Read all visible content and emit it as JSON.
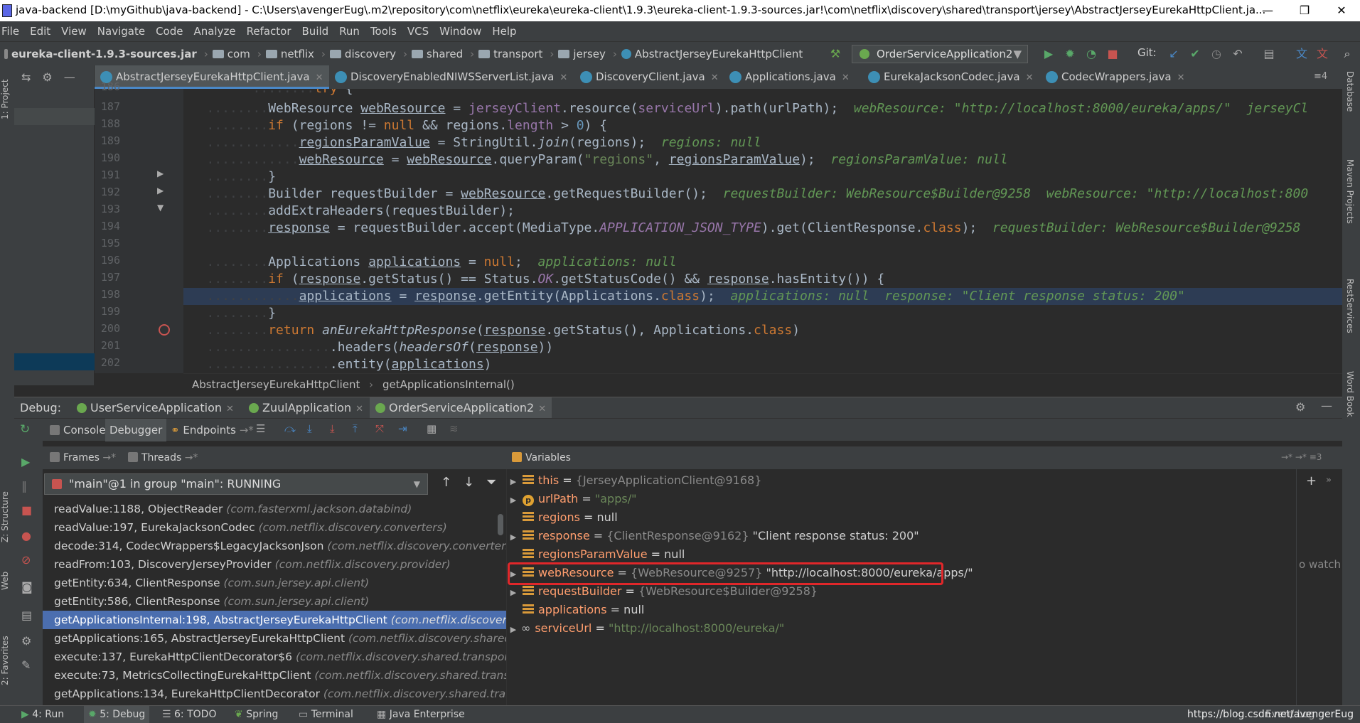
{
  "window": {
    "title": "java-backend [D:\\myGithub\\java-backend] - C:\\Users\\avengerEug\\.m2\\repository\\com\\netflix\\eureka\\eureka-client\\1.9.3\\eureka-client-1.9.3-sources.jar!\\com\\netflix\\discovery\\shared\\transport\\jersey\\AbstractJerseyEurekaHttpClient.ja...",
    "minimize": "—",
    "restore": "❐",
    "close": "✕"
  },
  "menu": [
    "File",
    "Edit",
    "View",
    "Navigate",
    "Code",
    "Analyze",
    "Refactor",
    "Build",
    "Run",
    "Tools",
    "VCS",
    "Window",
    "Help"
  ],
  "nav": {
    "jar": "eureka-client-1.9.3-sources.jar",
    "crumbs": [
      "com",
      "netflix",
      "discovery",
      "shared",
      "transport",
      "jersey"
    ],
    "cls": "AbstractJerseyEurekaHttpClient",
    "run_config": "OrderServiceApplication2",
    "git_label": "Git:"
  },
  "side": {
    "project": "1: Project",
    "structure": "Z: Structure",
    "web": "Web",
    "favorites": "2: Favorites",
    "database": "Database",
    "maven": "Maven Projects",
    "rest": "RestServices",
    "wordbook": "Word Book"
  },
  "tabs": [
    {
      "label": "AbstractJerseyEurekaHttpClient.java",
      "active": true
    },
    {
      "label": "DiscoveryEnabledNIWSServerList.java",
      "active": false
    },
    {
      "label": "DiscoveryClient.java",
      "active": false
    },
    {
      "label": "Applications.java",
      "active": false
    },
    {
      "label": "EurekaJacksonCodec.java",
      "active": false
    },
    {
      "label": "CodecWrappers.java",
      "active": false
    }
  ],
  "tabs_more": "≡4",
  "line_numbers": [
    "186",
    "187",
    "188",
    "189",
    "190",
    "191",
    "192",
    "193",
    "194",
    "195",
    "196",
    "197",
    "198",
    "199",
    "200",
    "201",
    "202"
  ],
  "editor_breadcrumb": {
    "cls": "AbstractJerseyEurekaHttpClient",
    "method": "getApplicationsInternal()"
  },
  "debug": {
    "label": "Debug:",
    "sessions": [
      "UserServiceApplication",
      "ZuulApplication",
      "OrderServiceApplication2"
    ],
    "toolbar": {
      "console": "Console",
      "debugger": "Debugger",
      "endpoints": "Endpoints"
    },
    "frames_label": "Frames",
    "threads_label": "Threads",
    "thread_selected": "\"main\"@1 in group \"main\": RUNNING",
    "frames": [
      {
        "m": "readValue:1188, ObjectReader",
        "p": "(com.fasterxml.jackson.databind)",
        "sel": false
      },
      {
        "m": "readValue:197, EurekaJacksonCodec",
        "p": "(com.netflix.discovery.converters)",
        "sel": false
      },
      {
        "m": "decode:314, CodecWrappers$LegacyJacksonJson",
        "p": "(com.netflix.discovery.converters.wra",
        "sel": false
      },
      {
        "m": "readFrom:103, DiscoveryJerseyProvider",
        "p": "(com.netflix.discovery.provider)",
        "sel": false
      },
      {
        "m": "getEntity:634, ClientResponse",
        "p": "(com.sun.jersey.api.client)",
        "sel": false
      },
      {
        "m": "getEntity:586, ClientResponse",
        "p": "(com.sun.jersey.api.client)",
        "sel": false
      },
      {
        "m": "getApplicationsInternal:198, AbstractJerseyEurekaHttpClient",
        "p": "(com.netflix.discovery.sha",
        "sel": true
      },
      {
        "m": "getApplications:165, AbstractJerseyEurekaHttpClient",
        "p": "(com.netflix.discovery.shared.tran",
        "sel": false
      },
      {
        "m": "execute:137, EurekaHttpClientDecorator$6",
        "p": "(com.netflix.discovery.shared.transport.dec",
        "sel": false
      },
      {
        "m": "execute:73, MetricsCollectingEurekaHttpClient",
        "p": "(com.netflix.discovery.shared.transport.",
        "sel": false
      },
      {
        "m": "getApplications:134, EurekaHttpClientDecorator",
        "p": "(com.netflix.discovery.shared.transpo",
        "sel": false
      }
    ],
    "variables_label": "Variables",
    "watches_hint": "o watch",
    "variables": [
      {
        "name": "this",
        "eq": " = ",
        "ref": "{JerseyApplicationClient@9168}",
        "val": "",
        "str": "",
        "exp": true,
        "icon": "field"
      },
      {
        "name": "urlPath",
        "eq": " = ",
        "ref": "",
        "val": "",
        "str": "\"apps/\"",
        "exp": true,
        "icon": "p"
      },
      {
        "name": "regions",
        "eq": " = ",
        "ref": "",
        "val": "null",
        "str": "",
        "exp": false,
        "icon": "field"
      },
      {
        "name": "response",
        "eq": " = ",
        "ref": "{ClientResponse@9162}",
        "val": " \"Client response status: 200\"",
        "str": "",
        "exp": true,
        "icon": "field"
      },
      {
        "name": "regionsParamValue",
        "eq": " = ",
        "ref": "",
        "val": "null",
        "str": "",
        "exp": false,
        "icon": "field"
      },
      {
        "name": "webResource",
        "eq": " = ",
        "ref": "{WebResource@9257}",
        "val": " \"http://localhost:8000/eureka/apps/\"",
        "str": "",
        "exp": true,
        "icon": "field"
      },
      {
        "name": "requestBuilder",
        "eq": " = ",
        "ref": "{WebResource$Builder@9258}",
        "val": "",
        "str": "",
        "exp": true,
        "icon": "field"
      },
      {
        "name": "applications",
        "eq": " = ",
        "ref": "",
        "val": "null",
        "str": "",
        "exp": false,
        "icon": "field"
      },
      {
        "name": "serviceUrl",
        "eq": " = ",
        "ref": "",
        "val": "",
        "str": "\"http://localhost:8000/eureka/\"",
        "exp": true,
        "icon": "oo"
      }
    ]
  },
  "status": {
    "run": "4: Run",
    "debug": "5: Debug",
    "todo": "6: TODO",
    "spring": "Spring",
    "terminal": "Terminal",
    "javaee": "Java Enterprise",
    "event_log": "Event Log",
    "watermark": "https://blog.csdn.net/avengerEug"
  }
}
